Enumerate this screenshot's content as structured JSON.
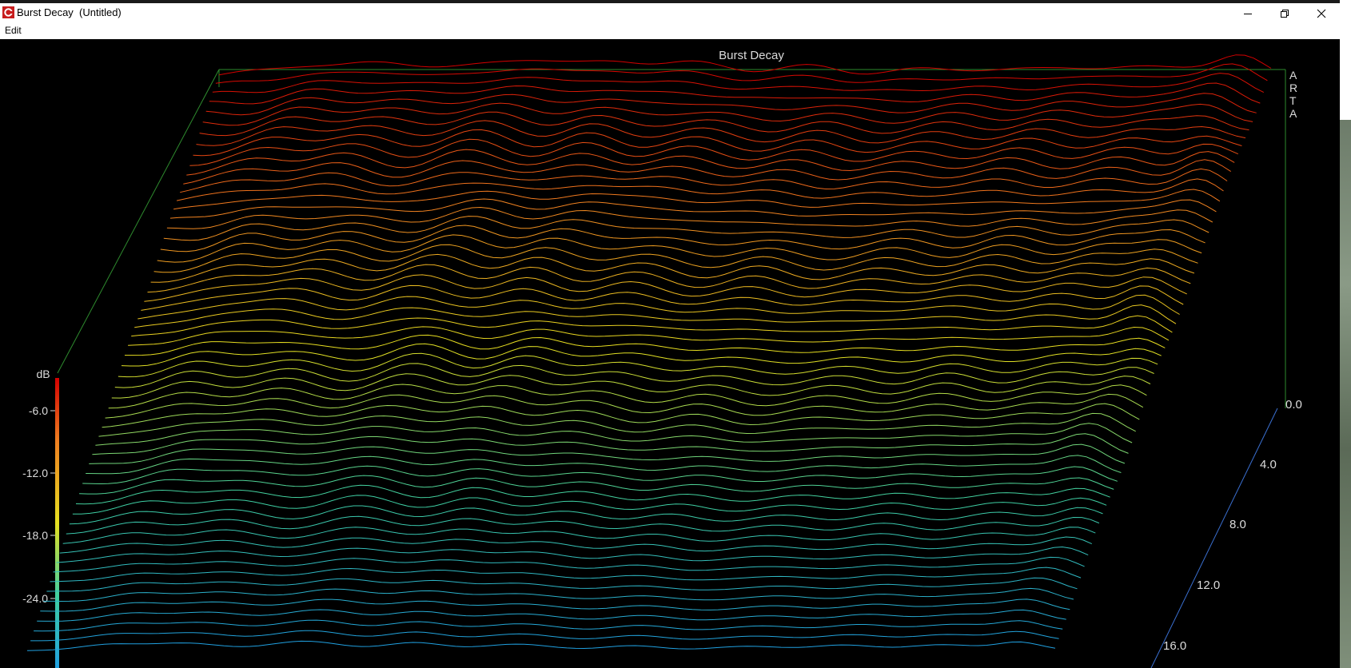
{
  "window": {
    "title": "Burst Decay  (Untitled)",
    "controls": [
      "minimize",
      "restore",
      "close"
    ]
  },
  "menu": {
    "items": [
      "Edit"
    ]
  },
  "chart_data": {
    "type": "waterfall",
    "title": "Burst Decay",
    "brand": "ARTA",
    "colorbar": {
      "unit": "dB",
      "ticks": [
        "-6.0",
        "-12.0",
        "-18.0",
        "-24.0"
      ],
      "colors": [
        "#d40000",
        "#f08020",
        "#e6e020",
        "#40d0a0",
        "#20a0e0"
      ]
    },
    "depth_axis": {
      "ticks": [
        "0.0",
        "4.0",
        "8.0",
        "12.0",
        "16.0"
      ]
    },
    "background": "#000000",
    "frame_color": "#2e8b2e"
  }
}
